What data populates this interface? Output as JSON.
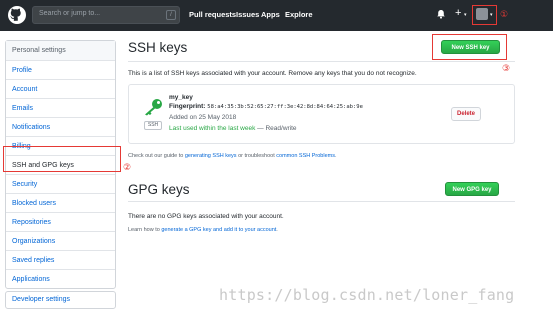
{
  "header": {
    "search_placeholder": "Search or jump to...",
    "slash_key": "/",
    "nav": [
      "Pull requests",
      "Issues",
      "Apps",
      "Explore"
    ],
    "plus_label": "+",
    "caret": "▾"
  },
  "annotations": {
    "one": "①",
    "two": "②",
    "three": "③"
  },
  "sidebar": {
    "items": [
      "Personal settings",
      "Profile",
      "Account",
      "Emails",
      "Notifications",
      "Billing",
      "SSH and GPG keys",
      "Security",
      "Blocked users",
      "Repositories",
      "Organizations",
      "Saved replies",
      "Applications"
    ],
    "developer_settings": "Developer settings"
  },
  "ssh": {
    "title": "SSH keys",
    "new_button": "New SSH key",
    "intro": "This is a list of SSH keys associated with your account. Remove any keys that you do not recognize.",
    "key": {
      "name": "my_key",
      "fingerprint_label": "Fingerprint:",
      "fingerprint": "58:a4:35:3b:52:65:27:ff:3e:42:8d:84:64:25:ab:9e",
      "added": "Added on 25 May 2018",
      "last_used": "Last used within the last week",
      "access": " — Read/write",
      "badge": "SSH",
      "delete_label": "Delete"
    },
    "guide_prefix": "Check out our guide to ",
    "guide_link": "generating SSH keys",
    "guide_mid": " or troubleshoot ",
    "guide_link2": "common SSH Problems",
    "guide_suffix": "."
  },
  "gpg": {
    "title": "GPG keys",
    "new_button": "New GPG key",
    "empty": "There are no GPG keys associated with your account.",
    "learn_prefix": "Learn how to ",
    "learn_link": "generate a GPG key and add it to your account",
    "learn_suffix": "."
  },
  "watermark": "https://blog.csdn.net/loner_fang",
  "colors": {
    "header_bg": "#24292e",
    "link": "#0366d6",
    "green": "#28a745",
    "annotation_red": "#e53935"
  }
}
